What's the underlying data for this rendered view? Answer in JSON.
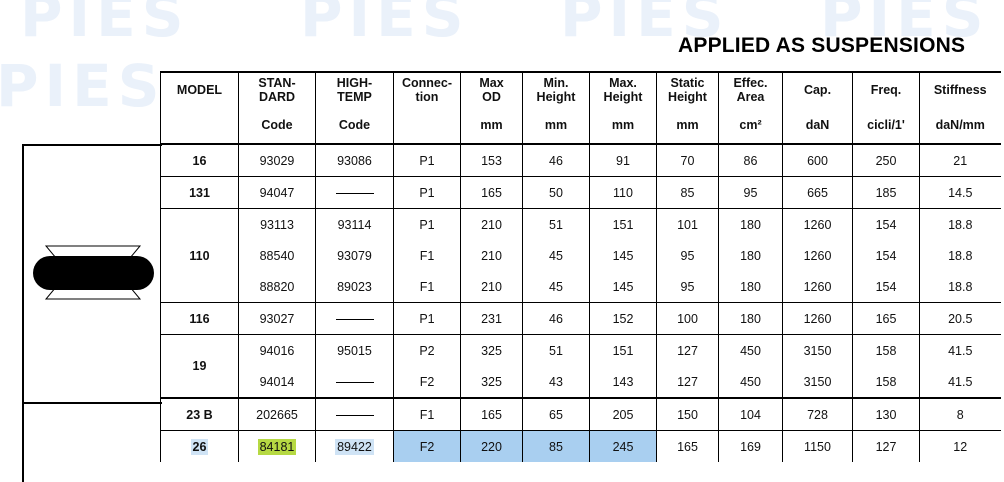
{
  "watermark": "PIES",
  "page_title": "APPLIED AS SUSPENSIONS",
  "headers": [
    {
      "line1": "MODEL",
      "line2": "",
      "unit": ""
    },
    {
      "line1": "STAN-",
      "line2": "DARD",
      "unit": "Code"
    },
    {
      "line1": "HIGH-",
      "line2": "TEMP",
      "unit": "Code"
    },
    {
      "line1": "Connec-",
      "line2": "tion",
      "unit": ""
    },
    {
      "line1": "Max",
      "line2": "OD",
      "unit": "mm"
    },
    {
      "line1": "Min.",
      "line2": "Height",
      "unit": "mm"
    },
    {
      "line1": "Max.",
      "line2": "Height",
      "unit": "mm"
    },
    {
      "line1": "Static",
      "line2": "Height",
      "unit": "mm"
    },
    {
      "line1": "Effec.",
      "line2": "Area",
      "unit": "cm²"
    },
    {
      "line1": "Cap.",
      "line2": "",
      "unit": "daN"
    },
    {
      "line1": "Freq.",
      "line2": "",
      "unit": "cicli/1'"
    },
    {
      "line1": "Stiffness",
      "line2": "",
      "unit": "daN/mm"
    }
  ],
  "rows": [
    [
      "16",
      "93029",
      "93086",
      "P1",
      "153",
      "46",
      "91",
      "70",
      "86",
      "600",
      "250",
      "21"
    ],
    [
      "131",
      "94047",
      "",
      "P1",
      "165",
      "50",
      "110",
      "85",
      "95",
      "665",
      "185",
      "14.5"
    ],
    [
      "110",
      "93113",
      "93114",
      "P1",
      "210",
      "51",
      "151",
      "101",
      "180",
      "1260",
      "154",
      "18.8"
    ],
    [
      "",
      "88540",
      "93079",
      "F1",
      "210",
      "45",
      "145",
      "95",
      "180",
      "1260",
      "154",
      "18.8"
    ],
    [
      "",
      "88820",
      "89023",
      "F1",
      "210",
      "45",
      "145",
      "95",
      "180",
      "1260",
      "154",
      "18.8"
    ],
    [
      "116",
      "93027",
      "",
      "P1",
      "231",
      "46",
      "152",
      "100",
      "180",
      "1260",
      "165",
      "20.5"
    ],
    [
      "19",
      "94016",
      "95015",
      "P2",
      "325",
      "51",
      "151",
      "127",
      "450",
      "3150",
      "158",
      "41.5"
    ],
    [
      "",
      "94014",
      "",
      "F2",
      "325",
      "43",
      "143",
      "127",
      "450",
      "3150",
      "158",
      "41.5"
    ],
    [
      "23 B",
      "202665",
      "",
      "F1",
      "165",
      "65",
      "205",
      "150",
      "104",
      "728",
      "130",
      "8"
    ],
    [
      "26",
      "84181",
      "89422",
      "F2",
      "220",
      "85",
      "245",
      "165",
      "169",
      "1150",
      "127",
      "12"
    ]
  ],
  "colors": {
    "highlight_green": "#b6d943",
    "highlight_blue": "#a9cff0"
  }
}
